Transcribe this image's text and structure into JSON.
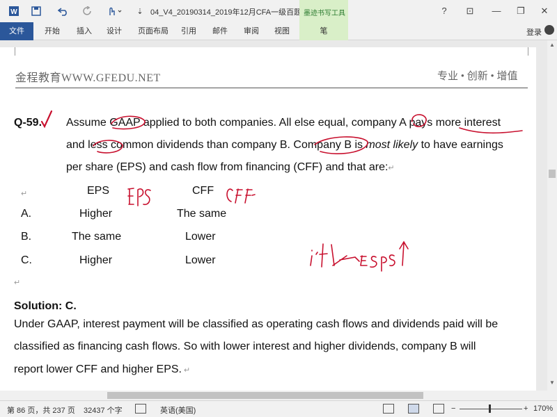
{
  "titlebar": {
    "document_title": "04_V4_20190314_2019年12月CFA一级百题...",
    "context_tab_group": "墨迹书写工具",
    "help": "?",
    "restore_ribbon": "⊡",
    "minimize": "—",
    "maximize": "❐",
    "close": "✕"
  },
  "ribbon": {
    "tabs": [
      "文件",
      "开始",
      "插入",
      "设计",
      "页面布局",
      "引用",
      "邮件",
      "审阅",
      "视图",
      "笔"
    ],
    "login": "登录"
  },
  "document": {
    "header_left": "金程教育WWW.GFEDU.NET",
    "header_right": "专业 • 创新 • 增值",
    "question_number": "Q-59.",
    "question_lines": [
      "Assume GAAP applied to both companies. All else equal, company A pays more interest",
      "and less common dividends than company B. Company B is ",
      "most likely",
      " to have earnings",
      "per share (EPS) and cash flow from financing (CFF) and that are:"
    ],
    "table": {
      "headers": [
        "EPS",
        "CFF"
      ],
      "rows": [
        {
          "option": "A.",
          "eps": "Higher",
          "cff": "The same"
        },
        {
          "option": "B.",
          "eps": "The same",
          "cff": "Lower"
        },
        {
          "option": "C.",
          "eps": "Higher",
          "cff": "Lower"
        }
      ]
    },
    "solution_heading": "Solution: C.",
    "solution_lines": [
      "Under GAAP, interest payment will be classified as operating cash flows and dividends paid will be",
      "classified as financing cash flows. So with lower interest and higher dividends, company B will",
      "report lower CFF and higher EPS."
    ],
    "ink_annotations": [
      "EPS",
      "CFF",
      "i'nt ↓ → EPS↑"
    ]
  },
  "statusbar": {
    "page": "第 86 页，共 237 页",
    "words": "32437 个字",
    "language": "英语(美国)",
    "zoom": "170%",
    "zoom_level_percent": 170
  }
}
